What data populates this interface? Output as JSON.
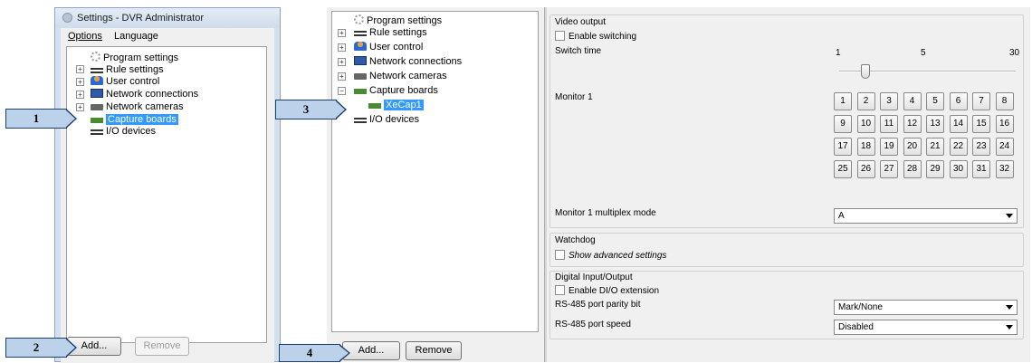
{
  "left_window": {
    "title": "Settings - DVR Administrator",
    "menu": [
      "Options",
      "Language"
    ],
    "tree": [
      {
        "label": "Program settings",
        "icon": "gear-icon"
      },
      {
        "label": "Rule settings",
        "icon": "arrows-icon"
      },
      {
        "label": "User control",
        "icon": "user-icon"
      },
      {
        "label": "Network connections",
        "icon": "monitor-icon"
      },
      {
        "label": "Network cameras",
        "icon": "camera-icon"
      },
      {
        "label": "Capture boards",
        "icon": "board-icon",
        "selected": true
      },
      {
        "label": "I/O devices",
        "icon": "arrows-icon"
      }
    ],
    "add_label": "Add...",
    "remove_label": "Remove"
  },
  "right_window": {
    "tree": [
      {
        "label": "Program settings"
      },
      {
        "label": "Rule settings"
      },
      {
        "label": "User control"
      },
      {
        "label": "Network connections"
      },
      {
        "label": "Network cameras"
      },
      {
        "label": "Capture boards"
      },
      {
        "label": "XeCap1",
        "selected": true
      },
      {
        "label": "I/O devices"
      }
    ],
    "add_label": "Add...",
    "remove_label": "Remove",
    "video_output": {
      "group_label": "Video output",
      "enable_switching_label": "Enable switching",
      "switch_time_label": "Switch time",
      "slider_ticks": [
        "1",
        "5",
        "30"
      ],
      "monitor_label": "Monitor 1",
      "monitor_buttons": [
        "1",
        "2",
        "3",
        "4",
        "5",
        "6",
        "7",
        "8",
        "9",
        "10",
        "11",
        "12",
        "13",
        "14",
        "15",
        "16",
        "17",
        "18",
        "19",
        "20",
        "21",
        "22",
        "23",
        "24",
        "25",
        "26",
        "27",
        "28",
        "29",
        "30",
        "31",
        "32"
      ],
      "multiplex_label": "Monitor 1 multiplex mode",
      "multiplex_value": "A"
    },
    "watchdog": {
      "group_label": "Watchdog",
      "advanced_label": "Show advanced settings"
    },
    "digital_io": {
      "group_label": "Digital Input/Output",
      "enable_label": "Enable DI/O extension",
      "parity_label": "RS-485 port parity bit",
      "parity_value": "Mark/None",
      "speed_label": "RS-485 port speed",
      "speed_value": "Disabled"
    }
  },
  "callouts": [
    "1",
    "2",
    "3",
    "4"
  ]
}
